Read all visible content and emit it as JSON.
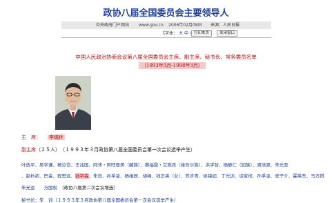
{
  "page": {
    "title": "政协八届全国委员会主要领导人",
    "source_site": "中央政府门户网站",
    "url_text": "www.gov.cn",
    "date": "2006年02月08日",
    "source": "来源：人民日报",
    "font_size_label": "【字体：",
    "font_sizes": [
      "大",
      "中",
      "小"
    ],
    "font_size_close": "】",
    "print_button": "打印本页",
    "close_button": "关闭窗口"
  },
  "article": {
    "subtitle": "中国人民政治协商会议第八届全国委员会主席、副主席、秘书长、常务委员名单",
    "date_range": "（1993年3月-1998年3月）",
    "chair_label": "主　席：",
    "chair_name": "李瑞环",
    "vice_label": "副主席",
    "vice_count": "（２５人）",
    "vice_note": "（１９９３年３月政协第八届全国委员会第一次会议选举产生）",
    "vice_line1": "叶选平、吴学谦、杨汝岱、王兆国、阿沛・阿旺晋美（藏族）、赛福鼎・艾则孜（维吾尔族）、洪学智、杨静仁（回族）、周培源、朱光亚",
    "vice_line2_before": "、赵朴初、巴金、程思远、",
    "vice_line2_hl": "钱学森",
    "vice_line2_after": "、朱良、孙孚凌、杨维辰、胡绳、钱正英（女）、苏步青、侯镜如、丁光训、谈家桢、孙孚凌、安子介、霍英东、马万祺",
    "vice_line3_names": "朱光亚　　万国权",
    "vice_line3_note": "（政协八届第二次会议增选）",
    "cut_line": "秘书长：朱　训（１９９３年３月政协第八届全国委员会第一次会议选举产生）"
  }
}
